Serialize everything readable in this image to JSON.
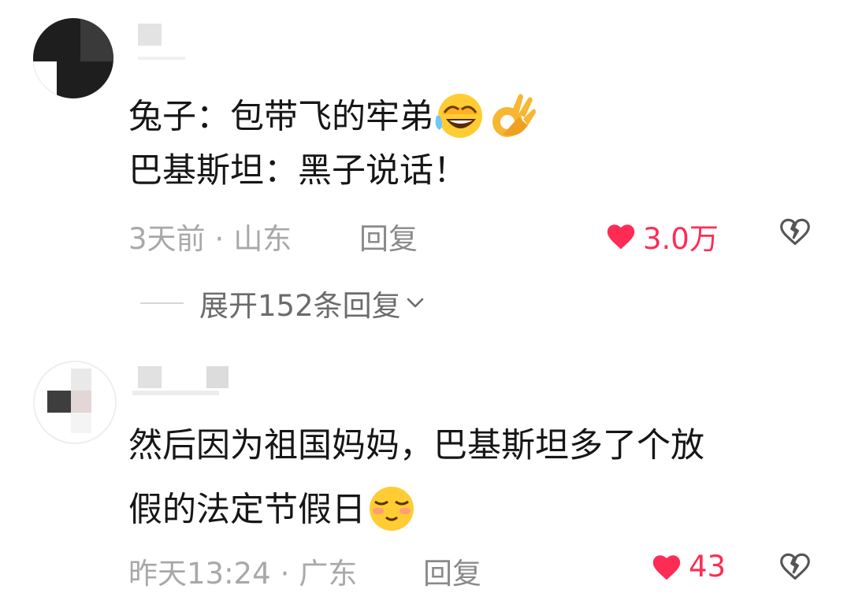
{
  "comments": [
    {
      "lines": [
        "兔子：包带飞的牢弟",
        "巴基斯坦：黑子说话！"
      ],
      "time": "3天前",
      "location": "山东",
      "reply_label": "回复",
      "likes": "3.0万"
    },
    {
      "lines": [
        "然后因为祖国妈妈，巴基斯坦多了个放",
        "假的法定节假日"
      ],
      "time": "昨天13:24",
      "location": "广东",
      "reply_label": "回复",
      "likes": "43"
    }
  ],
  "expand_replies": "展开152条回复",
  "colors": {
    "like": "#fe2c55",
    "meta": "#a8a8a8",
    "text": "#161616"
  },
  "icons": [
    "heart-icon",
    "dislike-heart-icon",
    "chevron-down-icon",
    "laughing-crying-emoji",
    "ok-hand-emoji",
    "smiling-emoji"
  ]
}
